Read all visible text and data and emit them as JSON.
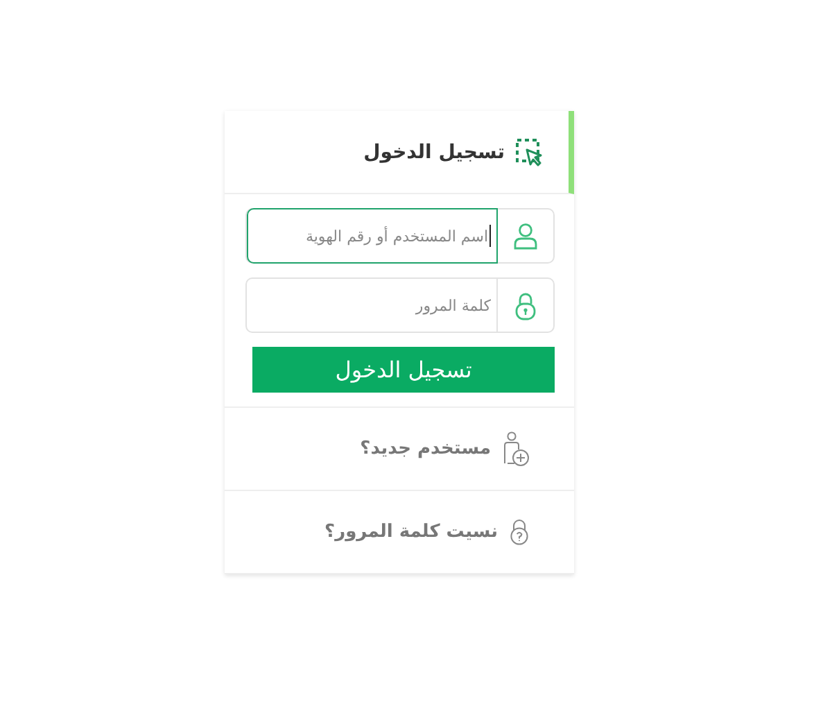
{
  "header": {
    "title": "تسجيل الدخول",
    "active": true
  },
  "fields": [
    {
      "placeholder": "اسم المستخدم أو رقم الهوية",
      "kind": "user",
      "focused": true
    },
    {
      "placeholder": "كلمة المرور",
      "kind": "lock",
      "focused": false
    }
  ],
  "submit": "تسجيل الدخول",
  "links": [
    {
      "label": "مستخدم جديد؟",
      "kind": "new-user"
    },
    {
      "label": "نسيت كلمة المرور؟",
      "kind": "forgot"
    }
  ]
}
